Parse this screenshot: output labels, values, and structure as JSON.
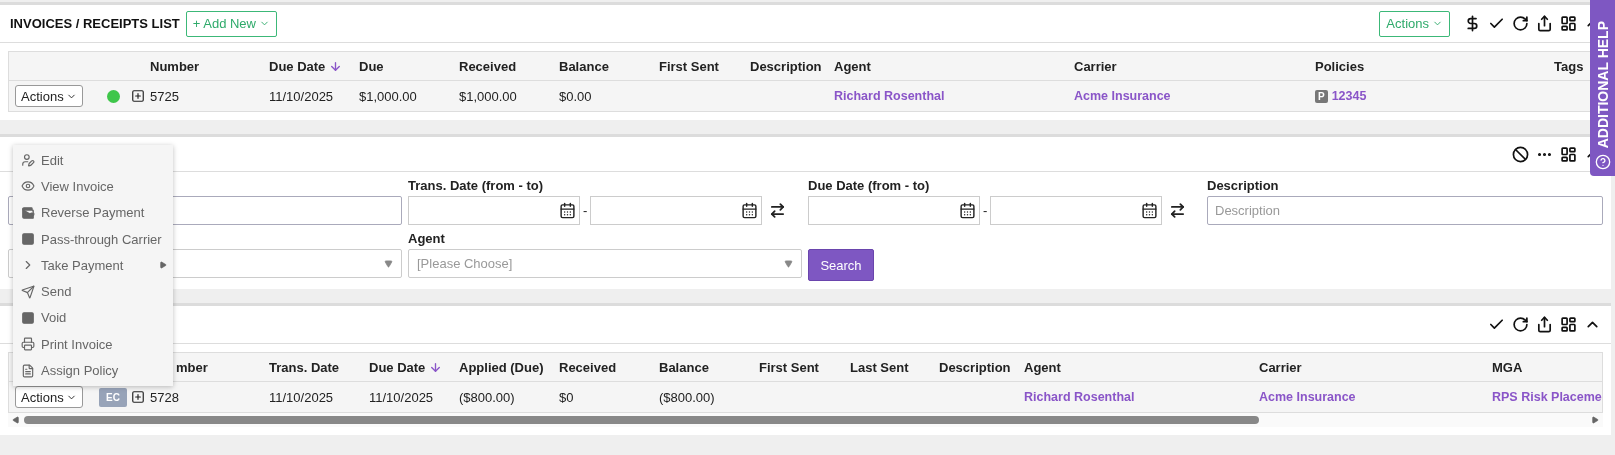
{
  "help_tab": {
    "label": "ADDITIONAL HELP"
  },
  "invoices_panel": {
    "title": "INVOICES / RECEIPTS LIST",
    "add_button": "+ Add New",
    "actions_button": "Actions",
    "columns": [
      {
        "label": "Number",
        "sorted": false
      },
      {
        "label": "Due Date",
        "sorted": true
      },
      {
        "label": "Due",
        "sorted": false
      },
      {
        "label": "Received",
        "sorted": false
      },
      {
        "label": "Balance",
        "sorted": false
      },
      {
        "label": "First Sent",
        "sorted": false
      },
      {
        "label": "Description",
        "sorted": false
      },
      {
        "label": "Agent",
        "sorted": false
      },
      {
        "label": "Carrier",
        "sorted": false
      },
      {
        "label": "Policies",
        "sorted": false
      },
      {
        "label": "Tags",
        "sorted": false
      }
    ],
    "rows": [
      {
        "actions": "Actions",
        "color": "#3ec64a",
        "expanded": false,
        "cells": [
          {
            "kind": "text",
            "text": "5725"
          },
          {
            "kind": "text",
            "text": "11/10/2025"
          },
          {
            "kind": "text",
            "text": "$1,000.00"
          },
          {
            "kind": "text",
            "text": "$1,000.00"
          },
          {
            "kind": "text",
            "text": "$0.00"
          },
          {
            "kind": "blank"
          },
          {
            "kind": "blank"
          },
          {
            "kind": "link",
            "text": "Richard Rosenthal"
          },
          {
            "kind": "link",
            "text": "Acme Insurance"
          },
          {
            "kind": "policy",
            "badge": "P",
            "text": "12345"
          },
          {
            "kind": "blank"
          }
        ]
      }
    ]
  },
  "search_panel": {
    "rows": [
      [
        {
          "kind": "text"
        },
        {
          "kind": "date_range",
          "label": "Trans. Date (from - to)",
          "separator": "-"
        },
        {
          "kind": "date_range",
          "label": "Due Date (from - to)",
          "separator": "-"
        },
        {
          "kind": "text",
          "label": "Description",
          "placeholder": "Description"
        }
      ],
      [
        {
          "kind": "select"
        },
        {
          "kind": "select",
          "label": "Agent",
          "placeholder": "[Please Choose]"
        },
        {
          "kind": "button",
          "label": "Search"
        }
      ]
    ]
  },
  "credits_panel": {
    "columns": [
      {
        "label": "mber",
        "sorted": false
      },
      {
        "label": "Trans. Date",
        "sorted": false
      },
      {
        "label": "Due Date",
        "sorted": true
      },
      {
        "label": "Applied (Due)",
        "sorted": false
      },
      {
        "label": "Received",
        "sorted": false
      },
      {
        "label": "Balance",
        "sorted": false
      },
      {
        "label": "First Sent",
        "sorted": false
      },
      {
        "label": "Last Sent",
        "sorted": false
      },
      {
        "label": "Description",
        "sorted": false
      },
      {
        "label": "Agent",
        "sorted": false
      },
      {
        "label": "Carrier",
        "sorted": false
      },
      {
        "label": "MGA",
        "sorted": false
      }
    ],
    "rows": [
      {
        "actions": "Actions",
        "status_badge": "EC",
        "expanded": false,
        "cells": [
          {
            "kind": "text",
            "text": "5728"
          },
          {
            "kind": "text",
            "text": "11/10/2025"
          },
          {
            "kind": "text",
            "text": "11/10/2025"
          },
          {
            "kind": "text",
            "text": "($800.00)"
          },
          {
            "kind": "text",
            "text": "$0"
          },
          {
            "kind": "text",
            "text": "($800.00)"
          },
          {
            "kind": "blank"
          },
          {
            "kind": "blank"
          },
          {
            "kind": "blank"
          },
          {
            "kind": "link",
            "text": "Richard Rosenthal"
          },
          {
            "kind": "link",
            "text": "Acme Insurance"
          },
          {
            "kind": "link",
            "text": "RPS Risk Placeme"
          }
        ]
      }
    ]
  },
  "actions_menu": {
    "items": [
      {
        "label": "Edit",
        "has_submenu": false
      },
      {
        "label": "View Invoice",
        "has_submenu": false
      },
      {
        "label": "Reverse Payment",
        "has_submenu": false
      },
      {
        "label": "Pass-through Carrier",
        "has_submenu": false
      },
      {
        "label": "Take Payment",
        "has_submenu": true
      },
      {
        "label": "Send",
        "has_submenu": false
      },
      {
        "label": "Void",
        "has_submenu": false
      },
      {
        "label": "Print Invoice",
        "has_submenu": false
      },
      {
        "label": "Assign Policy",
        "has_submenu": false
      }
    ]
  }
}
